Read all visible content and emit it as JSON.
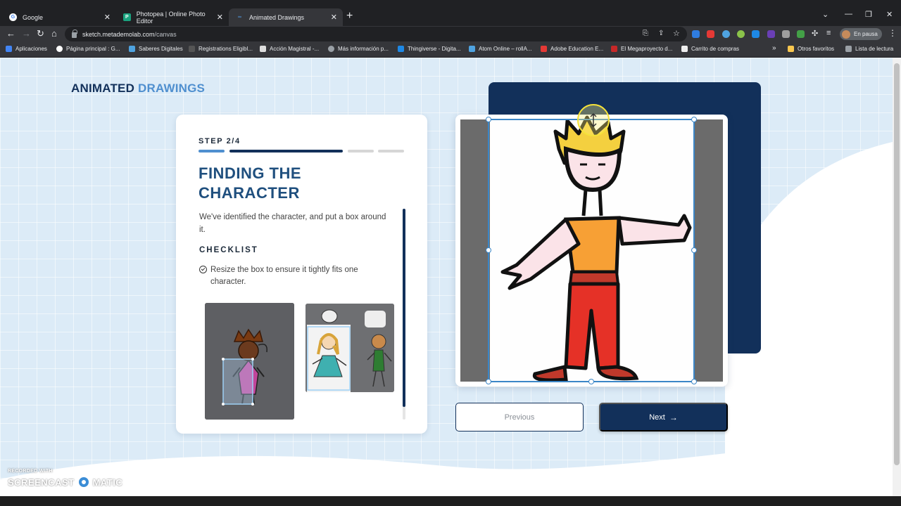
{
  "browser": {
    "tabs": [
      {
        "label": "Google"
      },
      {
        "label": "Photopea | Online Photo Editor"
      },
      {
        "label": "Animated Drawings"
      }
    ],
    "url_domain": "sketch.metademolab.com",
    "url_path": "/canvas",
    "profile_label": "En pausa",
    "bookmarks": [
      "Aplicaciones",
      "Página principal : G...",
      "Saberes Digitales",
      "Registrations Eligibl...",
      "Acción Magistral -...",
      "Más información p...",
      "Thingiverse - Digita...",
      "Atom Online – rollA...",
      "Adobe Education E...",
      "El Megaproyecto d...",
      "Carrito de compras",
      "Otros favoritos",
      "Lista de lectura"
    ],
    "overflow_label": "»"
  },
  "page": {
    "brand_part1": "ANIMATED",
    "brand_part2": "DRAWINGS",
    "step": "STEP 2/4",
    "progress": {
      "current": 2,
      "total": 4
    },
    "heading": "FINDING THE CHARACTER",
    "description": "We've identified the character, and put a box around it.",
    "checklist_title": "CHECKLIST",
    "checklist_items": [
      "Resize the box to ensure it tightly fits one character."
    ],
    "previous_label": "Previous",
    "next_label": "Next"
  },
  "watermark": {
    "line1": "RECORDED WITH",
    "line2a": "SCREENCAST",
    "line2b": "MATIC"
  },
  "colors": {
    "navy": "#12305a",
    "accent_blue": "#4f8fcf",
    "bounding_box": "#3b86c7"
  }
}
